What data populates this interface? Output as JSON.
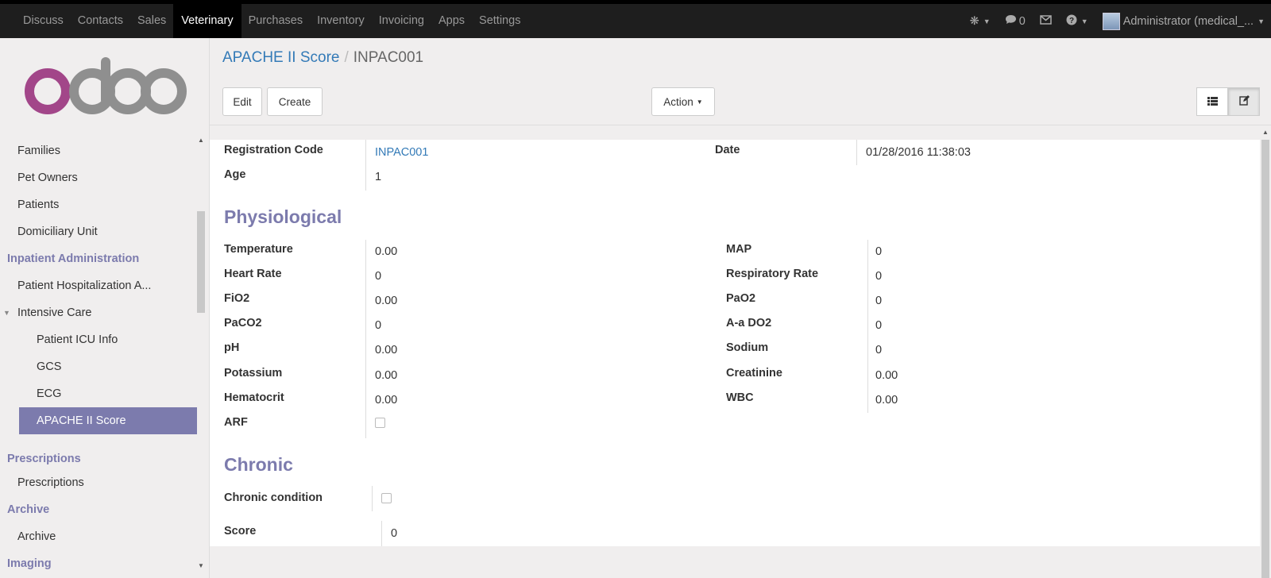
{
  "topbar": {
    "menu": [
      "Discuss",
      "Contacts",
      "Sales",
      "Veterinary",
      "Purchases",
      "Inventory",
      "Invoicing",
      "Apps",
      "Settings"
    ],
    "active_menu": "Veterinary",
    "messages_count": "0",
    "user": "Administrator (medical_..."
  },
  "sidebar": {
    "logo_text": "odoo",
    "items": {
      "families": "Families",
      "pet_owners": "Pet Owners",
      "patients": "Patients",
      "domiciliary_unit": "Domiciliary Unit",
      "section_inpatient": "Inpatient Administration",
      "patient_hospitalization": "Patient Hospitalization A...",
      "intensive_care": "Intensive Care",
      "patient_icu_info": "Patient ICU Info",
      "gcs": "GCS",
      "ecg": "ECG",
      "apache": "APACHE II Score",
      "section_prescriptions": "Prescriptions",
      "prescriptions": "Prescriptions",
      "section_archive": "Archive",
      "archive": "Archive",
      "section_imaging": "Imaging"
    }
  },
  "control_panel": {
    "breadcrumb_parent": "APACHE II Score",
    "breadcrumb_current": "INPAC001",
    "edit_label": "Edit",
    "create_label": "Create",
    "action_label": "Action"
  },
  "form": {
    "registration_code_label": "Registration Code",
    "registration_code": "INPAC001",
    "date_label": "Date",
    "date": "01/28/2016 11:38:03",
    "age_label": "Age",
    "age": "1",
    "physiological_title": "Physiological",
    "left_fields": [
      {
        "label": "Temperature",
        "value": "0.00"
      },
      {
        "label": "Heart Rate",
        "value": "0"
      },
      {
        "label": "FiO2",
        "value": "0.00"
      },
      {
        "label": "PaCO2",
        "value": "0"
      },
      {
        "label": "pH",
        "value": "0.00"
      },
      {
        "label": "Potassium",
        "value": "0.00"
      },
      {
        "label": "Hematocrit",
        "value": "0.00"
      },
      {
        "label": "ARF",
        "value": ""
      }
    ],
    "right_fields": [
      {
        "label": "MAP",
        "value": "0"
      },
      {
        "label": "Respiratory Rate",
        "value": "0"
      },
      {
        "label": "PaO2",
        "value": "0"
      },
      {
        "label": "A-a DO2",
        "value": "0"
      },
      {
        "label": "Sodium",
        "value": "0"
      },
      {
        "label": "Creatinine",
        "value": "0.00"
      },
      {
        "label": "WBC",
        "value": "0.00"
      }
    ],
    "chronic_title": "Chronic",
    "chronic_condition_label": "Chronic condition",
    "score_label": "Score",
    "score": "0"
  },
  "colors": {
    "topbar": "#1e1e1e",
    "accent": "#7c7bad",
    "link": "#337ab7",
    "odoo_purple": "#a24689",
    "odoo_grey": "#8f8f8f"
  }
}
